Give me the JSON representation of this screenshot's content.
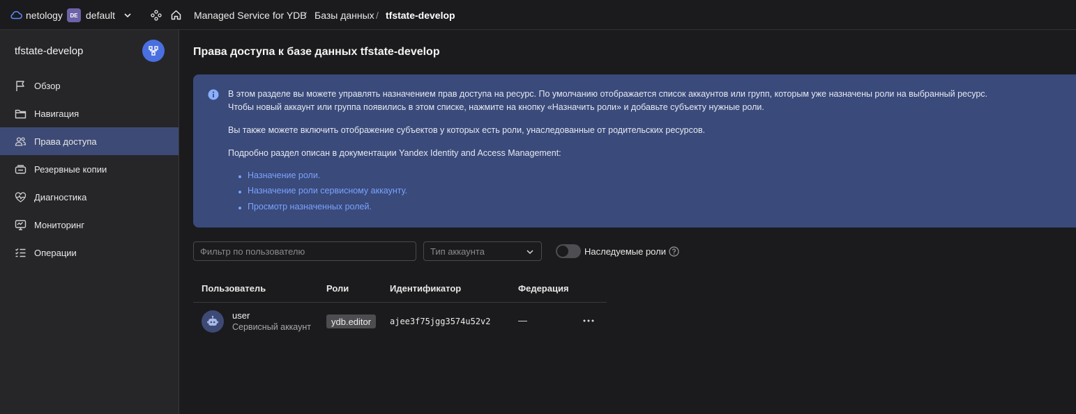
{
  "topbar": {
    "org_name": "netology",
    "folder_badge": "DE",
    "folder_name": "default",
    "breadcrumbs": [
      "Managed Service for YDB",
      "Базы данных",
      "tfstate-develop"
    ],
    "separator": "/"
  },
  "sidebar": {
    "title": "tfstate-develop",
    "items": [
      {
        "label": "Обзор",
        "icon": "flag-icon"
      },
      {
        "label": "Навигация",
        "icon": "folder-icon"
      },
      {
        "label": "Права доступа",
        "icon": "persons-icon",
        "active": true
      },
      {
        "label": "Резервные копии",
        "icon": "backup-icon"
      },
      {
        "label": "Диагностика",
        "icon": "heart-pulse-icon"
      },
      {
        "label": "Мониторинг",
        "icon": "monitor-icon"
      },
      {
        "label": "Операции",
        "icon": "list-check-icon"
      }
    ]
  },
  "main": {
    "title": "Права доступа к базе данных tfstate-develop",
    "info": {
      "line1": "В этом разделе вы можете управлять назначением прав доступа на ресурс. По умолчанию отображается список аккаунтов или групп, которым уже назначены роли на выбранный ресурс.",
      "line2": "Чтобы новый аккаунт или группа появились в этом списке, нажмите на кнопку «Назначить роли» и добавьте субъекту нужные роли.",
      "line3": "Вы также можете включить отображение субъектов у которых есть роли, унаследованные от родительских ресурсов.",
      "line4": "Подробно раздел описан в документации Yandex Identity and Access Management:",
      "links": [
        "Назначение роли.",
        "Назначение роли сервисному аккаунту.",
        "Просмотр назначенных ролей."
      ]
    },
    "filters": {
      "user_placeholder": "Фильтр по пользователю",
      "account_type_placeholder": "Тип аккаунта",
      "inherited_roles_label": "Наследуемые роли",
      "inherited_roles_enabled": false
    },
    "table": {
      "columns": [
        "Пользователь",
        "Роли",
        "Идентификатор",
        "Федерация"
      ],
      "rows": [
        {
          "name": "user",
          "type": "Сервисный аккаунт",
          "role": "ydb.editor",
          "id": "ajee3f75jgg3574u52v2",
          "federation": "—"
        }
      ]
    }
  },
  "colors": {
    "accent": "#4a6fe0",
    "active_bg": "#3d4a75",
    "info_bg": "#3a4a7a",
    "link": "#79a3ff"
  }
}
